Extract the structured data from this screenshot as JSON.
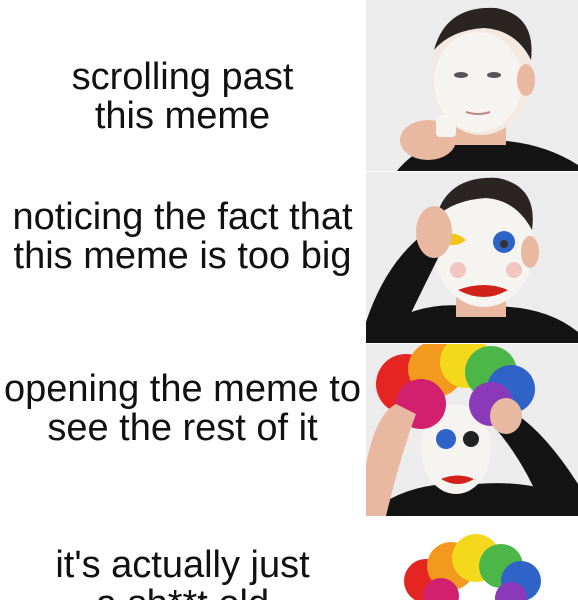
{
  "panels": [
    {
      "caption": "scrolling past this meme",
      "photo": "clown-makeup-stage-1-white-base"
    },
    {
      "caption": "noticing the fact that this meme is too big",
      "photo": "clown-makeup-stage-2-red-lips-blue-eye"
    },
    {
      "caption": "opening the meme to see the rest of it",
      "photo": "clown-makeup-stage-3-rainbow-wig"
    },
    {
      "caption": "it's actually just a sh**t old",
      "photo": "clown-makeup-stage-4-full-clown"
    }
  ],
  "colors": {
    "skin": "#e8b9a0",
    "face_paint": "#f6f4f1",
    "hair": "#2a2522",
    "shirt": "#141414",
    "lips": "#d2201b",
    "eye_blue": "#2f63c8",
    "eye_yellow": "#f0c419",
    "background": "#ececec"
  }
}
